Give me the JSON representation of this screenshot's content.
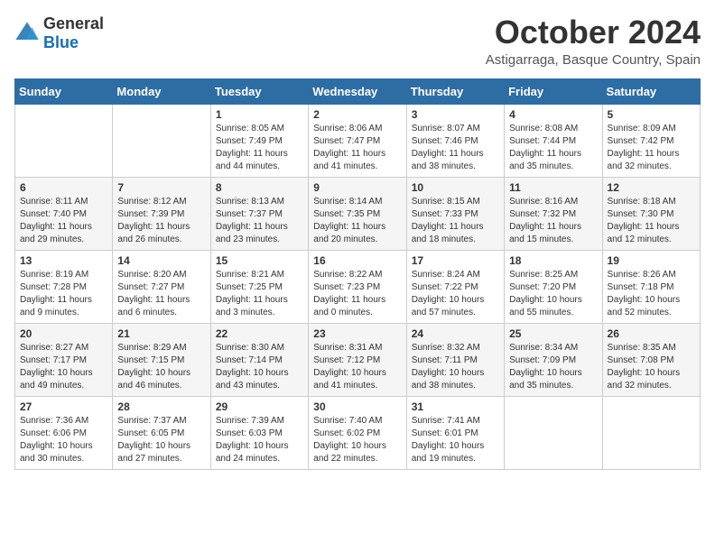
{
  "header": {
    "logo_general": "General",
    "logo_blue": "Blue",
    "title": "October 2024",
    "subtitle": "Astigarraga, Basque Country, Spain"
  },
  "calendar": {
    "days_of_week": [
      "Sunday",
      "Monday",
      "Tuesday",
      "Wednesday",
      "Thursday",
      "Friday",
      "Saturday"
    ],
    "weeks": [
      [
        {
          "day": "",
          "info": ""
        },
        {
          "day": "",
          "info": ""
        },
        {
          "day": "1",
          "info": "Sunrise: 8:05 AM\nSunset: 7:49 PM\nDaylight: 11 hours and 44 minutes."
        },
        {
          "day": "2",
          "info": "Sunrise: 8:06 AM\nSunset: 7:47 PM\nDaylight: 11 hours and 41 minutes."
        },
        {
          "day": "3",
          "info": "Sunrise: 8:07 AM\nSunset: 7:46 PM\nDaylight: 11 hours and 38 minutes."
        },
        {
          "day": "4",
          "info": "Sunrise: 8:08 AM\nSunset: 7:44 PM\nDaylight: 11 hours and 35 minutes."
        },
        {
          "day": "5",
          "info": "Sunrise: 8:09 AM\nSunset: 7:42 PM\nDaylight: 11 hours and 32 minutes."
        }
      ],
      [
        {
          "day": "6",
          "info": "Sunrise: 8:11 AM\nSunset: 7:40 PM\nDaylight: 11 hours and 29 minutes."
        },
        {
          "day": "7",
          "info": "Sunrise: 8:12 AM\nSunset: 7:39 PM\nDaylight: 11 hours and 26 minutes."
        },
        {
          "day": "8",
          "info": "Sunrise: 8:13 AM\nSunset: 7:37 PM\nDaylight: 11 hours and 23 minutes."
        },
        {
          "day": "9",
          "info": "Sunrise: 8:14 AM\nSunset: 7:35 PM\nDaylight: 11 hours and 20 minutes."
        },
        {
          "day": "10",
          "info": "Sunrise: 8:15 AM\nSunset: 7:33 PM\nDaylight: 11 hours and 18 minutes."
        },
        {
          "day": "11",
          "info": "Sunrise: 8:16 AM\nSunset: 7:32 PM\nDaylight: 11 hours and 15 minutes."
        },
        {
          "day": "12",
          "info": "Sunrise: 8:18 AM\nSunset: 7:30 PM\nDaylight: 11 hours and 12 minutes."
        }
      ],
      [
        {
          "day": "13",
          "info": "Sunrise: 8:19 AM\nSunset: 7:28 PM\nDaylight: 11 hours and 9 minutes."
        },
        {
          "day": "14",
          "info": "Sunrise: 8:20 AM\nSunset: 7:27 PM\nDaylight: 11 hours and 6 minutes."
        },
        {
          "day": "15",
          "info": "Sunrise: 8:21 AM\nSunset: 7:25 PM\nDaylight: 11 hours and 3 minutes."
        },
        {
          "day": "16",
          "info": "Sunrise: 8:22 AM\nSunset: 7:23 PM\nDaylight: 11 hours and 0 minutes."
        },
        {
          "day": "17",
          "info": "Sunrise: 8:24 AM\nSunset: 7:22 PM\nDaylight: 10 hours and 57 minutes."
        },
        {
          "day": "18",
          "info": "Sunrise: 8:25 AM\nSunset: 7:20 PM\nDaylight: 10 hours and 55 minutes."
        },
        {
          "day": "19",
          "info": "Sunrise: 8:26 AM\nSunset: 7:18 PM\nDaylight: 10 hours and 52 minutes."
        }
      ],
      [
        {
          "day": "20",
          "info": "Sunrise: 8:27 AM\nSunset: 7:17 PM\nDaylight: 10 hours and 49 minutes."
        },
        {
          "day": "21",
          "info": "Sunrise: 8:29 AM\nSunset: 7:15 PM\nDaylight: 10 hours and 46 minutes."
        },
        {
          "day": "22",
          "info": "Sunrise: 8:30 AM\nSunset: 7:14 PM\nDaylight: 10 hours and 43 minutes."
        },
        {
          "day": "23",
          "info": "Sunrise: 8:31 AM\nSunset: 7:12 PM\nDaylight: 10 hours and 41 minutes."
        },
        {
          "day": "24",
          "info": "Sunrise: 8:32 AM\nSunset: 7:11 PM\nDaylight: 10 hours and 38 minutes."
        },
        {
          "day": "25",
          "info": "Sunrise: 8:34 AM\nSunset: 7:09 PM\nDaylight: 10 hours and 35 minutes."
        },
        {
          "day": "26",
          "info": "Sunrise: 8:35 AM\nSunset: 7:08 PM\nDaylight: 10 hours and 32 minutes."
        }
      ],
      [
        {
          "day": "27",
          "info": "Sunrise: 7:36 AM\nSunset: 6:06 PM\nDaylight: 10 hours and 30 minutes."
        },
        {
          "day": "28",
          "info": "Sunrise: 7:37 AM\nSunset: 6:05 PM\nDaylight: 10 hours and 27 minutes."
        },
        {
          "day": "29",
          "info": "Sunrise: 7:39 AM\nSunset: 6:03 PM\nDaylight: 10 hours and 24 minutes."
        },
        {
          "day": "30",
          "info": "Sunrise: 7:40 AM\nSunset: 6:02 PM\nDaylight: 10 hours and 22 minutes."
        },
        {
          "day": "31",
          "info": "Sunrise: 7:41 AM\nSunset: 6:01 PM\nDaylight: 10 hours and 19 minutes."
        },
        {
          "day": "",
          "info": ""
        },
        {
          "day": "",
          "info": ""
        }
      ]
    ]
  }
}
